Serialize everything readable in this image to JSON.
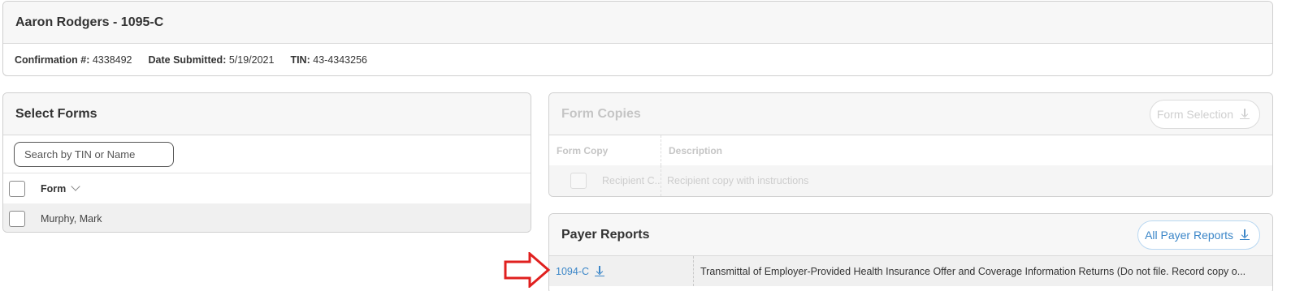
{
  "header": {
    "title": "Aaron Rodgers - 1095-C",
    "confirmation_label": "Confirmation #:",
    "confirmation_value": "4338492",
    "date_label": "Date Submitted:",
    "date_value": "5/19/2021",
    "tin_label": "TIN:",
    "tin_value": "43-4343256"
  },
  "select_forms": {
    "title": "Select Forms",
    "search_placeholder": "Search by TIN or Name",
    "column_header": "Form",
    "rows": [
      {
        "label": "Murphy, Mark"
      }
    ]
  },
  "form_copies": {
    "title": "Form Copies",
    "button_label": "Form Selection",
    "columns": [
      "Form Copy",
      "Description"
    ],
    "rows": [
      {
        "copy": "Recipient C...",
        "description": "Recipient copy with instructions"
      }
    ]
  },
  "payer_reports": {
    "title": "Payer Reports",
    "button_label": "All Payer Reports",
    "rows": [
      {
        "form": "1094-C",
        "description": "Transmittal of Employer-Provided Health Insurance Offer and Coverage Information Returns (Do not file. Record copy o..."
      }
    ]
  },
  "colors": {
    "link_blue": "#3b86c8",
    "annotation_red": "#e0201f"
  }
}
